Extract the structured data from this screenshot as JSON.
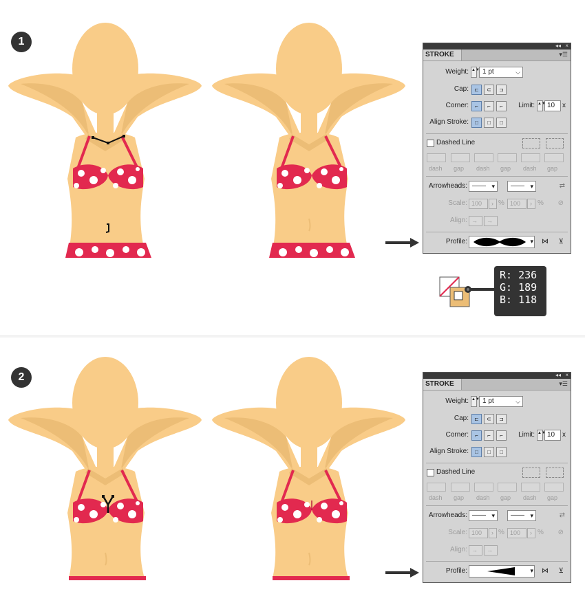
{
  "steps": [
    {
      "badge": "1",
      "panel": {
        "tab_title": "STROKE",
        "weight_label": "Weight:",
        "weight_value": "1 pt",
        "cap_label": "Cap:",
        "corner_label": "Corner:",
        "limit_label": "Limit:",
        "limit_value": "10",
        "limit_unit": "x",
        "align_label": "Align Stroke:",
        "dashed_label": "Dashed Line",
        "dash_labels": [
          "dash",
          "gap",
          "dash",
          "gap",
          "dash",
          "gap"
        ],
        "arrowheads_label": "Arrowheads:",
        "scale_label": "Scale:",
        "scale_value_1": "100",
        "scale_value_2": "100",
        "percent": "%",
        "align_arrow_label": "Align:",
        "profile_label": "Profile:",
        "profile_shape": "width-profile-bulge"
      },
      "color_callout": {
        "r": "R: 236",
        "g": "G: 189",
        "b": "B: 118"
      }
    },
    {
      "badge": "2",
      "panel": {
        "tab_title": "STROKE",
        "weight_label": "Weight:",
        "weight_value": "1 pt",
        "cap_label": "Cap:",
        "corner_label": "Corner:",
        "limit_label": "Limit:",
        "limit_value": "10",
        "limit_unit": "x",
        "align_label": "Align Stroke:",
        "dashed_label": "Dashed Line",
        "dash_labels": [
          "dash",
          "gap",
          "dash",
          "gap",
          "dash",
          "gap"
        ],
        "arrowheads_label": "Arrowheads:",
        "scale_label": "Scale:",
        "scale_value_1": "100",
        "scale_value_2": "100",
        "percent": "%",
        "align_arrow_label": "Align:",
        "profile_label": "Profile:",
        "profile_shape": "width-profile-taper"
      }
    }
  ],
  "colors": {
    "skin": "#f9cc88",
    "skin_shadow": "#ecbd76",
    "bikini": "#e2294f",
    "dots": "#ffffff",
    "badge": "#333333",
    "panel_bg": "#d4d4d4",
    "callout_bg": "#333333"
  }
}
